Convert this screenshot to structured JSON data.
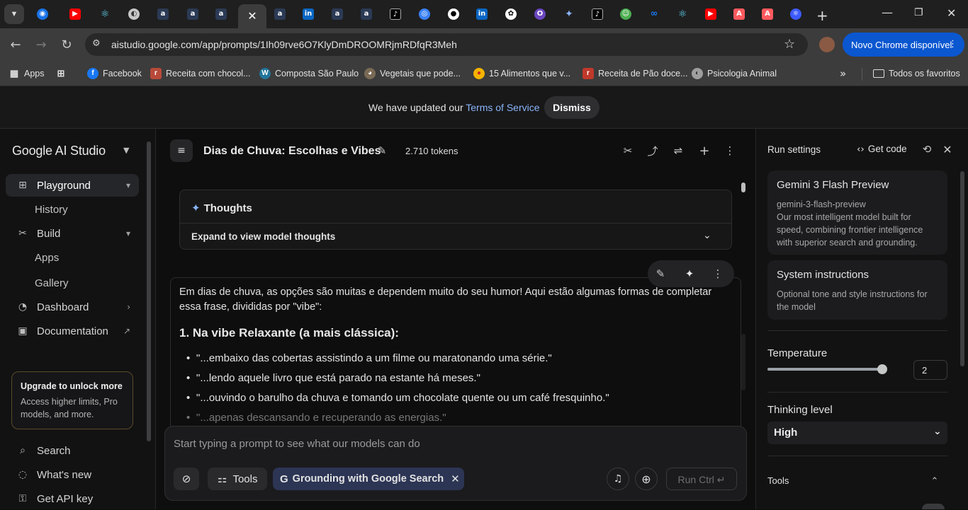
{
  "browser": {
    "url": "aistudio.google.com/app/prompts/1Ih09rve6O7KlyDmDROOMRjmRDfqR3Meh",
    "update_button": "Novo Chrome disponível",
    "tabs": [
      {
        "icon": "chevron-down-icon"
      },
      {
        "icon": "eye-icon"
      },
      {
        "icon": "youtube-icon"
      },
      {
        "icon": "react-icon"
      },
      {
        "icon": "globe-icon"
      },
      {
        "icon": "a-icon"
      },
      {
        "icon": "a-icon"
      },
      {
        "icon": "a-icon"
      },
      {
        "icon": "close-icon"
      },
      {
        "icon": "a-icon"
      },
      {
        "icon": "linkedin-icon"
      },
      {
        "icon": "a-icon"
      },
      {
        "icon": "a-icon"
      },
      {
        "icon": "tiktok-icon"
      },
      {
        "icon": "circle-icon"
      },
      {
        "icon": "github-icon"
      },
      {
        "icon": "linkedin-icon"
      },
      {
        "icon": "openai-icon"
      },
      {
        "icon": "opera-icon"
      },
      {
        "icon": "gemini-icon"
      },
      {
        "icon": "tiktok-icon"
      },
      {
        "icon": "pepe-icon"
      },
      {
        "icon": "meta-icon"
      },
      {
        "icon": "react-icon"
      },
      {
        "icon": "youtube-icon"
      },
      {
        "icon": "airbnb-icon"
      },
      {
        "icon": "airbnb-icon"
      },
      {
        "icon": "react-icon"
      }
    ]
  },
  "bookmarks": {
    "items": [
      {
        "label": "Apps"
      },
      {
        "label": "Facebook"
      },
      {
        "label": "Receita com chocol..."
      },
      {
        "label": "Composta São Paulo"
      },
      {
        "label": "Vegetais que pode..."
      },
      {
        "label": "15 Alimentos que v..."
      },
      {
        "label": "Receita de Pão doce..."
      },
      {
        "label": "Psicologia Animal"
      }
    ],
    "all_favorites": "Todos os favoritos"
  },
  "banner": {
    "text": "We have updated our",
    "link": "Terms of Service",
    "dismiss": "Dismiss"
  },
  "sidebar": {
    "brand": "Google AI Studio",
    "playground": "Playground",
    "history": "History",
    "build": "Build",
    "apps": "Apps",
    "gallery": "Gallery",
    "dashboard": "Dashboard",
    "documentation": "Documentation",
    "upgrade_title": "Upgrade to unlock more",
    "upgrade_text": "Access higher limits, Pro models, and more.",
    "search": "Search",
    "whats_new": "What's new",
    "get_api_key": "Get API key"
  },
  "main": {
    "title": "Dias de Chuva: Escolhas e Vibes",
    "tokens": "2.710 tokens",
    "thoughts_title": "Thoughts",
    "thoughts_expand": "Expand to view model thoughts",
    "response_intro": "Em dias de chuva, as opções são muitas e dependem muito do seu humor! Aqui estão algumas formas de completar essa frase, divididas por \"vibe\":",
    "section_heading": "1. Na vibe Relaxante (a mais clássica):",
    "bullets": [
      "\"...embaixo das cobertas assistindo a um filme ou maratonando uma série.\"",
      "\"...lendo aquele livro que está parado na estante há meses.\"",
      "\"...ouvindo o barulho da chuva e tomando um chocolate quente ou um café fresquinho.\"",
      "\"...apenas descansando e recuperando as energias.\""
    ],
    "prompt_placeholder": "Start typing a prompt to see what our models can do",
    "tools_label": "Tools",
    "grounding_label": "Grounding with Google Search",
    "run_label": "Run Ctrl ↵"
  },
  "run_settings": {
    "title": "Run settings",
    "get_code": "Get code",
    "model_name": "Gemini 3 Flash Preview",
    "model_id": "gemini-3-flash-preview",
    "model_desc": "Our most intelligent model built for speed, combining frontier intelligence with superior search and grounding.",
    "system_title": "System instructions",
    "system_desc": "Optional tone and style instructions for the model",
    "temperature_label": "Temperature",
    "temperature_value": "2",
    "temperature_fraction": 1.0,
    "thinking_label": "Thinking level",
    "thinking_value": "High",
    "tools_label": "Tools"
  }
}
